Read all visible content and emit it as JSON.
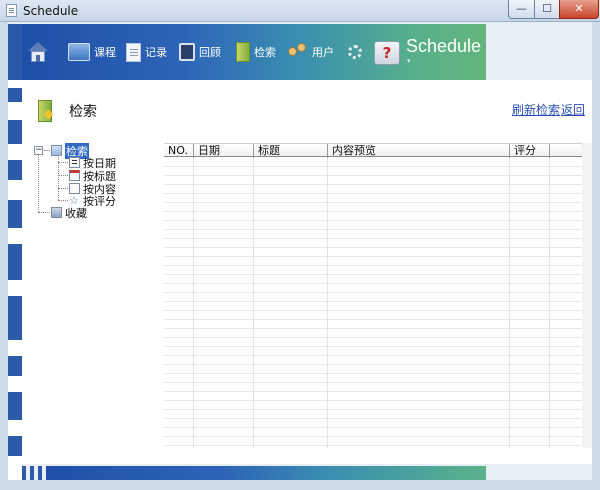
{
  "window": {
    "title": "Schedule",
    "controls": {
      "minimize": "—",
      "maximize": "☐",
      "close": "✕"
    }
  },
  "toolbar": {
    "home_icon": "home-icon",
    "items": [
      {
        "label": "课程",
        "icon": "course-icon"
      },
      {
        "label": "记录",
        "icon": "record-icon"
      },
      {
        "label": "回顾",
        "icon": "review-icon"
      },
      {
        "label": "检索",
        "icon": "search-icon"
      },
      {
        "label": "用户",
        "icon": "user-icon"
      }
    ],
    "settings_icon": "gear-icon",
    "help_icon": "help-icon",
    "help_symbol": "?",
    "brand": "Schedule",
    "brand_chevron": "▾"
  },
  "page": {
    "title": "检索",
    "refresh_label": "刷新检索",
    "back_label": "返回"
  },
  "tree": {
    "root": {
      "label": "检索",
      "expander": "−"
    },
    "children": [
      {
        "label": "按日期"
      },
      {
        "label": "按标题"
      },
      {
        "label": "按内容"
      },
      {
        "label": "按评分"
      }
    ],
    "favorites": {
      "label": "收藏"
    }
  },
  "grid": {
    "columns": [
      "NO.",
      "日期",
      "标题",
      "内容预览",
      "评分"
    ],
    "rows": []
  }
}
